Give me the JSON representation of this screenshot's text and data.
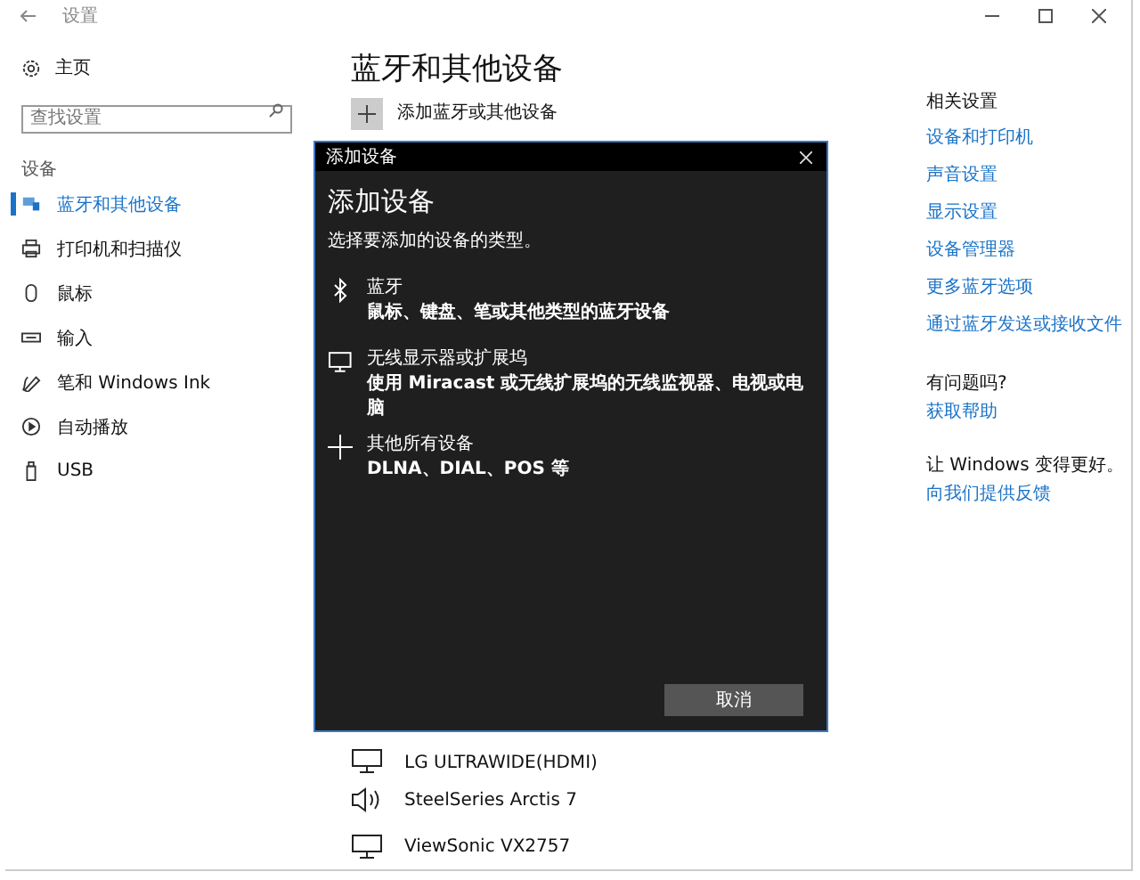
{
  "window": {
    "title": "设置"
  },
  "sidebar": {
    "home": "主页",
    "search": {
      "placeholder": "查找设置"
    },
    "section": "设备",
    "items": [
      {
        "label": "蓝牙和其他设备",
        "selected": true
      },
      {
        "label": "打印机和扫描仪",
        "selected": false
      },
      {
        "label": "鼠标",
        "selected": false
      },
      {
        "label": "输入",
        "selected": false
      },
      {
        "label": "笔和 Windows Ink",
        "selected": false
      },
      {
        "label": "自动播放",
        "selected": false
      },
      {
        "label": "USB",
        "selected": false
      }
    ]
  },
  "main": {
    "title": "蓝牙和其他设备",
    "add_button": "添加蓝牙或其他设备",
    "devices": [
      {
        "name": "LG ULTRAWIDE(HDMI)"
      },
      {
        "name": "SteelSeries Arctis 7"
      },
      {
        "name": "ViewSonic VX2757"
      }
    ]
  },
  "related": {
    "heading": "相关设置",
    "links": [
      "设备和打印机",
      "声音设置",
      "显示设置",
      "设备管理器",
      "更多蓝牙选项",
      "通过蓝牙发送或接收文件"
    ],
    "help_heading": "有问题吗?",
    "help_link": "获取帮助",
    "feedback_heading": "让 Windows 变得更好。",
    "feedback_link": "向我们提供反馈"
  },
  "dialog": {
    "title": "添加设备",
    "heading": "添加设备",
    "subtitle": "选择要添加的设备的类型。",
    "options": [
      {
        "title": "蓝牙",
        "description": "鼠标、键盘、笔或其他类型的蓝牙设备"
      },
      {
        "title": "无线显示器或扩展坞",
        "description": "使用 Miracast 或无线扩展坞的无线监视器、电视或电脑"
      },
      {
        "title": "其他所有设备",
        "description": "DLNA、DIAL、POS 等"
      }
    ],
    "cancel": "取消"
  }
}
